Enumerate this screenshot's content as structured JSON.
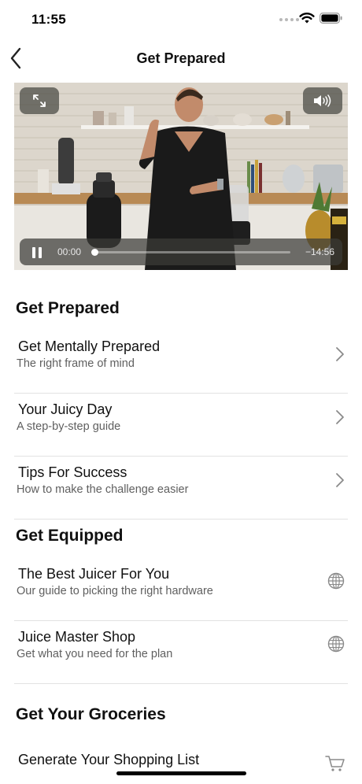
{
  "status_bar": {
    "time": "11:55"
  },
  "nav": {
    "title": "Get Prepared"
  },
  "video": {
    "time_current": "00:00",
    "time_remaining": "−14:56",
    "progress": 0.0
  },
  "sections": [
    {
      "title": "Get Prepared",
      "rows": [
        {
          "title": "Get Mentally Prepared",
          "subtitle": "The right frame of mind",
          "accessory": "chevron-right-icon"
        },
        {
          "title": "Your Juicy Day",
          "subtitle": "A step-by-step guide",
          "accessory": "chevron-right-icon"
        },
        {
          "title": "Tips For Success",
          "subtitle": "How to make the challenge easier",
          "accessory": "chevron-right-icon"
        }
      ]
    },
    {
      "title": "Get Equipped",
      "rows": [
        {
          "title": "The Best Juicer For You",
          "subtitle": "Our guide to picking the right hardware",
          "accessory": "globe-icon"
        },
        {
          "title": "Juice Master Shop",
          "subtitle": "Get what you need for the plan",
          "accessory": "globe-icon"
        }
      ]
    },
    {
      "title": "Get Your Groceries",
      "rows": [
        {
          "title": "Generate Your Shopping List",
          "subtitle": "",
          "accessory": "cart-icon"
        }
      ]
    }
  ]
}
